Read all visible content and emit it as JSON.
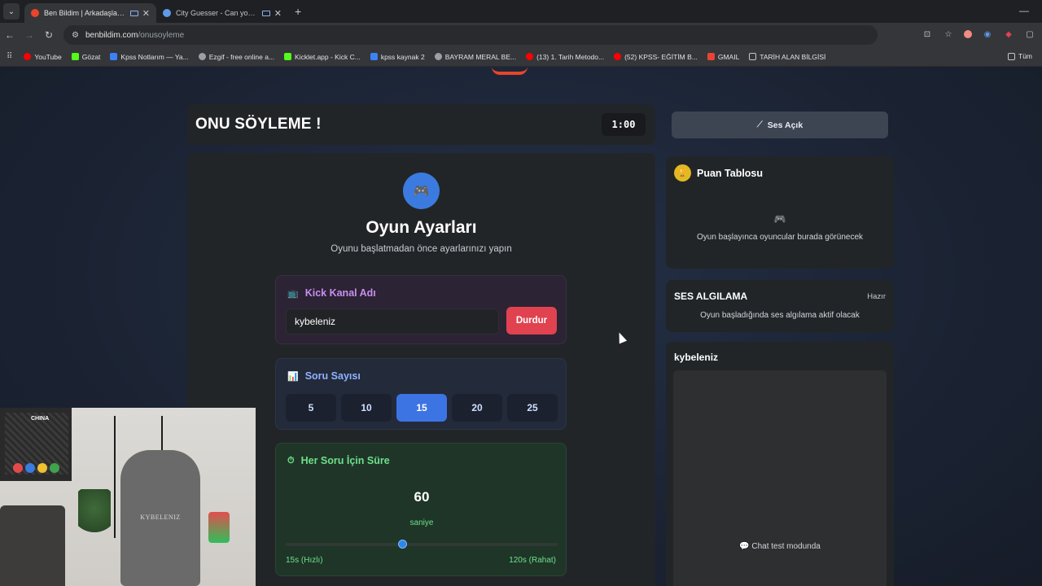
{
  "browser": {
    "tabs": [
      {
        "title": "Ben Bildim | Arkadaşlarınla",
        "active": true,
        "favicon_color": "#e8452a"
      },
      {
        "title": "City Guesser - Can you gue",
        "active": false,
        "favicon_color": "#5f9ae8"
      }
    ],
    "address": {
      "host": "benbildim.com",
      "path": "/onusoyleme"
    },
    "bookmarks": [
      {
        "label": "YouTube",
        "color": "#ff0000"
      },
      {
        "label": "Gözat",
        "color": "#53fc18"
      },
      {
        "label": "Kpss Notlarım — Ya...",
        "color": "#3b82f6"
      },
      {
        "label": "Ezgif - free online a...",
        "color": "#9aa0a6"
      },
      {
        "label": "Kicklet.app - Kick C...",
        "color": "#53fc18"
      },
      {
        "label": "kpss kaynak 2",
        "color": "#3b82f6"
      },
      {
        "label": "BAYRAM MERAL BE...",
        "color": "#9aa0a6"
      },
      {
        "label": "(13) 1. Tarih Metodo...",
        "color": "#ff0000"
      },
      {
        "label": "(52) KPSS- EĞİTİM B...",
        "color": "#ff0000"
      },
      {
        "label": "GMAIL",
        "color": "#ea4335"
      },
      {
        "label": "TARİH ALAN BİLGİSİ",
        "color": "#9aa0a6"
      }
    ],
    "bookmarks_overflow": "Tüm"
  },
  "header": {
    "title": "ONU SÖYLEME !",
    "timer": "1:00"
  },
  "settings": {
    "icon": "gamepad-icon",
    "title": "Oyun Ayarları",
    "subtitle": "Oyunu başlatmadan önce ayarlarınızı yapın",
    "kick": {
      "label": "Kick Kanal Adı",
      "value": "kybeleniz",
      "stop_label": "Durdur"
    },
    "question_count": {
      "label": "Soru Sayısı",
      "options": [
        "5",
        "10",
        "15",
        "20",
        "25"
      ],
      "selected": "15"
    },
    "time_per_question": {
      "label": "Her Soru İçin Süre",
      "value": "60",
      "unit": "saniye",
      "min_label": "15s (Hızlı)",
      "max_label": "120s (Rahat)",
      "min": 15,
      "max": 120,
      "current": 60
    }
  },
  "sidebar": {
    "sound_button": "Ses Açık",
    "scoreboard": {
      "title": "Puan Tablosu",
      "empty_text": "Oyun başlayınca oyuncular burada görünecek"
    },
    "voice": {
      "title": "SES ALGILAMA",
      "status": "Hazır",
      "note": "Oyun başladığında ses algılama aktif olacak"
    },
    "chat": {
      "title": "kybeleniz",
      "note": "Chat test modunda"
    }
  },
  "webcam": {
    "chair_label": "KYBELENIZ",
    "wall_sign": "CHINA"
  },
  "colors": {
    "accent_blue": "#3d74e4",
    "stop_red": "#e0424f",
    "time_green": "#6ee08a",
    "kick_purple": "#c88ff0"
  }
}
